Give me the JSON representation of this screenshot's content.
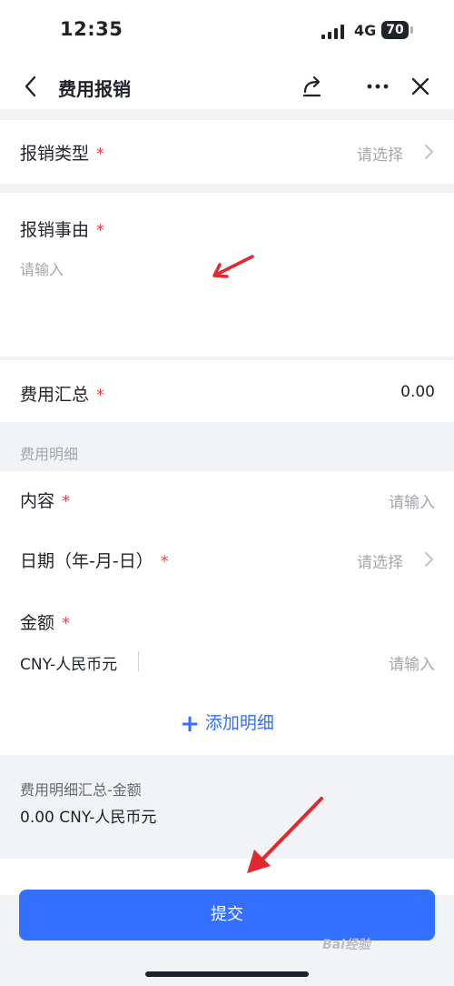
{
  "status_bar": {
    "time": "12:35",
    "network": "4G",
    "battery": "70"
  },
  "nav": {
    "title": "费用报销",
    "icons": {
      "back": "chevron-left-icon",
      "share": "share-icon",
      "more": "more-icon",
      "close": "close-icon"
    }
  },
  "form": {
    "type": {
      "label": "报销类型",
      "required": "*",
      "hint": "请选择"
    },
    "reason": {
      "label": "报销事由",
      "required": "*",
      "placeholder": "请输入"
    },
    "total": {
      "label": "费用汇总",
      "required": "*",
      "value": "0.00"
    },
    "details_header": "费用明细",
    "detail": {
      "content": {
        "label": "内容",
        "required": "*",
        "hint": "请输入"
      },
      "date": {
        "label": "日期（年-月-日）",
        "required": "*",
        "hint": "请选择"
      },
      "amount": {
        "label": "金额",
        "required": "*",
        "currency": "CNY-人民币元",
        "hint": "请输入"
      }
    },
    "add_detail": {
      "plus": "+",
      "label": "添加明细"
    },
    "summary": {
      "label": "费用明细汇总-金额",
      "value": "0.00 CNY-人民币元"
    }
  },
  "footer": {
    "submit_label": "提交"
  },
  "watermark": "Bai经验",
  "colors": {
    "primary": "#3370ff",
    "required": "#e5484d",
    "annotation": "#e0282e"
  }
}
